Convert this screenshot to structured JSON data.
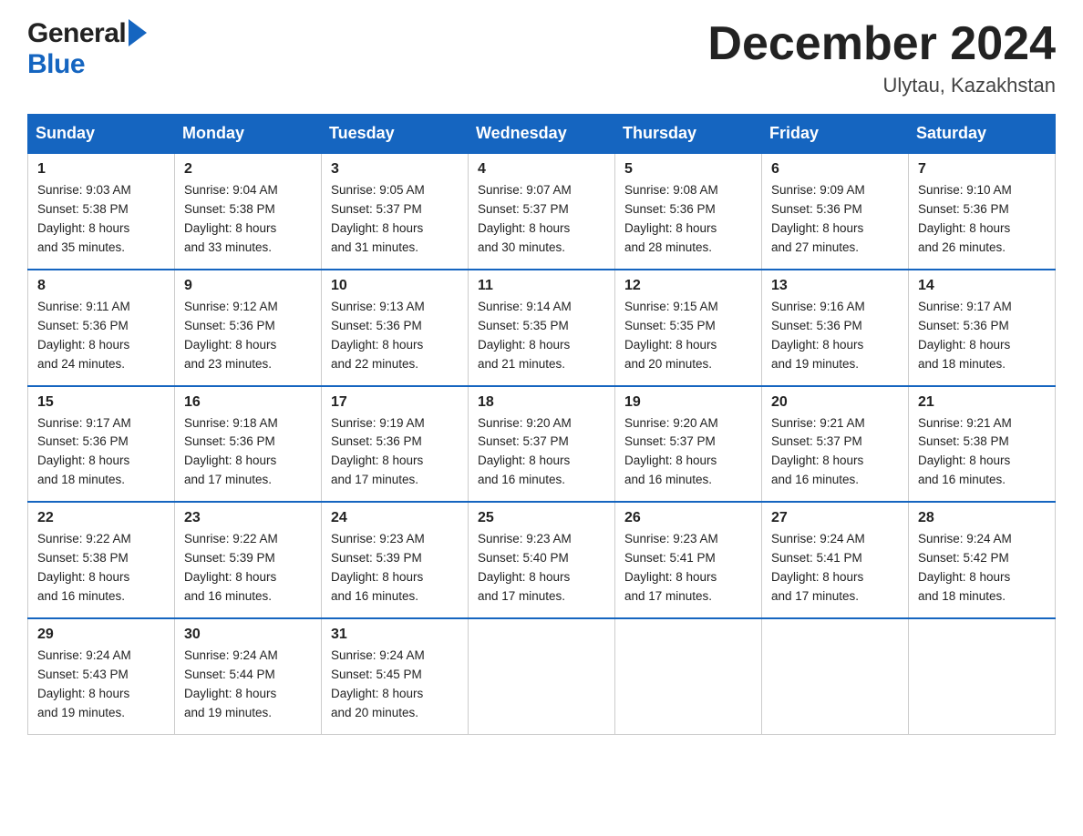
{
  "header": {
    "logo_general": "General",
    "logo_blue": "Blue",
    "month_title": "December 2024",
    "location": "Ulytau, Kazakhstan"
  },
  "days_of_week": [
    "Sunday",
    "Monday",
    "Tuesday",
    "Wednesday",
    "Thursday",
    "Friday",
    "Saturday"
  ],
  "weeks": [
    [
      {
        "day": "1",
        "sunrise": "Sunrise: 9:03 AM",
        "sunset": "Sunset: 5:38 PM",
        "daylight": "Daylight: 8 hours",
        "daylight2": "and 35 minutes."
      },
      {
        "day": "2",
        "sunrise": "Sunrise: 9:04 AM",
        "sunset": "Sunset: 5:38 PM",
        "daylight": "Daylight: 8 hours",
        "daylight2": "and 33 minutes."
      },
      {
        "day": "3",
        "sunrise": "Sunrise: 9:05 AM",
        "sunset": "Sunset: 5:37 PM",
        "daylight": "Daylight: 8 hours",
        "daylight2": "and 31 minutes."
      },
      {
        "day": "4",
        "sunrise": "Sunrise: 9:07 AM",
        "sunset": "Sunset: 5:37 PM",
        "daylight": "Daylight: 8 hours",
        "daylight2": "and 30 minutes."
      },
      {
        "day": "5",
        "sunrise": "Sunrise: 9:08 AM",
        "sunset": "Sunset: 5:36 PM",
        "daylight": "Daylight: 8 hours",
        "daylight2": "and 28 minutes."
      },
      {
        "day": "6",
        "sunrise": "Sunrise: 9:09 AM",
        "sunset": "Sunset: 5:36 PM",
        "daylight": "Daylight: 8 hours",
        "daylight2": "and 27 minutes."
      },
      {
        "day": "7",
        "sunrise": "Sunrise: 9:10 AM",
        "sunset": "Sunset: 5:36 PM",
        "daylight": "Daylight: 8 hours",
        "daylight2": "and 26 minutes."
      }
    ],
    [
      {
        "day": "8",
        "sunrise": "Sunrise: 9:11 AM",
        "sunset": "Sunset: 5:36 PM",
        "daylight": "Daylight: 8 hours",
        "daylight2": "and 24 minutes."
      },
      {
        "day": "9",
        "sunrise": "Sunrise: 9:12 AM",
        "sunset": "Sunset: 5:36 PM",
        "daylight": "Daylight: 8 hours",
        "daylight2": "and 23 minutes."
      },
      {
        "day": "10",
        "sunrise": "Sunrise: 9:13 AM",
        "sunset": "Sunset: 5:36 PM",
        "daylight": "Daylight: 8 hours",
        "daylight2": "and 22 minutes."
      },
      {
        "day": "11",
        "sunrise": "Sunrise: 9:14 AM",
        "sunset": "Sunset: 5:35 PM",
        "daylight": "Daylight: 8 hours",
        "daylight2": "and 21 minutes."
      },
      {
        "day": "12",
        "sunrise": "Sunrise: 9:15 AM",
        "sunset": "Sunset: 5:35 PM",
        "daylight": "Daylight: 8 hours",
        "daylight2": "and 20 minutes."
      },
      {
        "day": "13",
        "sunrise": "Sunrise: 9:16 AM",
        "sunset": "Sunset: 5:36 PM",
        "daylight": "Daylight: 8 hours",
        "daylight2": "and 19 minutes."
      },
      {
        "day": "14",
        "sunrise": "Sunrise: 9:17 AM",
        "sunset": "Sunset: 5:36 PM",
        "daylight": "Daylight: 8 hours",
        "daylight2": "and 18 minutes."
      }
    ],
    [
      {
        "day": "15",
        "sunrise": "Sunrise: 9:17 AM",
        "sunset": "Sunset: 5:36 PM",
        "daylight": "Daylight: 8 hours",
        "daylight2": "and 18 minutes."
      },
      {
        "day": "16",
        "sunrise": "Sunrise: 9:18 AM",
        "sunset": "Sunset: 5:36 PM",
        "daylight": "Daylight: 8 hours",
        "daylight2": "and 17 minutes."
      },
      {
        "day": "17",
        "sunrise": "Sunrise: 9:19 AM",
        "sunset": "Sunset: 5:36 PM",
        "daylight": "Daylight: 8 hours",
        "daylight2": "and 17 minutes."
      },
      {
        "day": "18",
        "sunrise": "Sunrise: 9:20 AM",
        "sunset": "Sunset: 5:37 PM",
        "daylight": "Daylight: 8 hours",
        "daylight2": "and 16 minutes."
      },
      {
        "day": "19",
        "sunrise": "Sunrise: 9:20 AM",
        "sunset": "Sunset: 5:37 PM",
        "daylight": "Daylight: 8 hours",
        "daylight2": "and 16 minutes."
      },
      {
        "day": "20",
        "sunrise": "Sunrise: 9:21 AM",
        "sunset": "Sunset: 5:37 PM",
        "daylight": "Daylight: 8 hours",
        "daylight2": "and 16 minutes."
      },
      {
        "day": "21",
        "sunrise": "Sunrise: 9:21 AM",
        "sunset": "Sunset: 5:38 PM",
        "daylight": "Daylight: 8 hours",
        "daylight2": "and 16 minutes."
      }
    ],
    [
      {
        "day": "22",
        "sunrise": "Sunrise: 9:22 AM",
        "sunset": "Sunset: 5:38 PM",
        "daylight": "Daylight: 8 hours",
        "daylight2": "and 16 minutes."
      },
      {
        "day": "23",
        "sunrise": "Sunrise: 9:22 AM",
        "sunset": "Sunset: 5:39 PM",
        "daylight": "Daylight: 8 hours",
        "daylight2": "and 16 minutes."
      },
      {
        "day": "24",
        "sunrise": "Sunrise: 9:23 AM",
        "sunset": "Sunset: 5:39 PM",
        "daylight": "Daylight: 8 hours",
        "daylight2": "and 16 minutes."
      },
      {
        "day": "25",
        "sunrise": "Sunrise: 9:23 AM",
        "sunset": "Sunset: 5:40 PM",
        "daylight": "Daylight: 8 hours",
        "daylight2": "and 17 minutes."
      },
      {
        "day": "26",
        "sunrise": "Sunrise: 9:23 AM",
        "sunset": "Sunset: 5:41 PM",
        "daylight": "Daylight: 8 hours",
        "daylight2": "and 17 minutes."
      },
      {
        "day": "27",
        "sunrise": "Sunrise: 9:24 AM",
        "sunset": "Sunset: 5:41 PM",
        "daylight": "Daylight: 8 hours",
        "daylight2": "and 17 minutes."
      },
      {
        "day": "28",
        "sunrise": "Sunrise: 9:24 AM",
        "sunset": "Sunset: 5:42 PM",
        "daylight": "Daylight: 8 hours",
        "daylight2": "and 18 minutes."
      }
    ],
    [
      {
        "day": "29",
        "sunrise": "Sunrise: 9:24 AM",
        "sunset": "Sunset: 5:43 PM",
        "daylight": "Daylight: 8 hours",
        "daylight2": "and 19 minutes."
      },
      {
        "day": "30",
        "sunrise": "Sunrise: 9:24 AM",
        "sunset": "Sunset: 5:44 PM",
        "daylight": "Daylight: 8 hours",
        "daylight2": "and 19 minutes."
      },
      {
        "day": "31",
        "sunrise": "Sunrise: 9:24 AM",
        "sunset": "Sunset: 5:45 PM",
        "daylight": "Daylight: 8 hours",
        "daylight2": "and 20 minutes."
      },
      {
        "day": "",
        "sunrise": "",
        "sunset": "",
        "daylight": "",
        "daylight2": ""
      },
      {
        "day": "",
        "sunrise": "",
        "sunset": "",
        "daylight": "",
        "daylight2": ""
      },
      {
        "day": "",
        "sunrise": "",
        "sunset": "",
        "daylight": "",
        "daylight2": ""
      },
      {
        "day": "",
        "sunrise": "",
        "sunset": "",
        "daylight": "",
        "daylight2": ""
      }
    ]
  ]
}
